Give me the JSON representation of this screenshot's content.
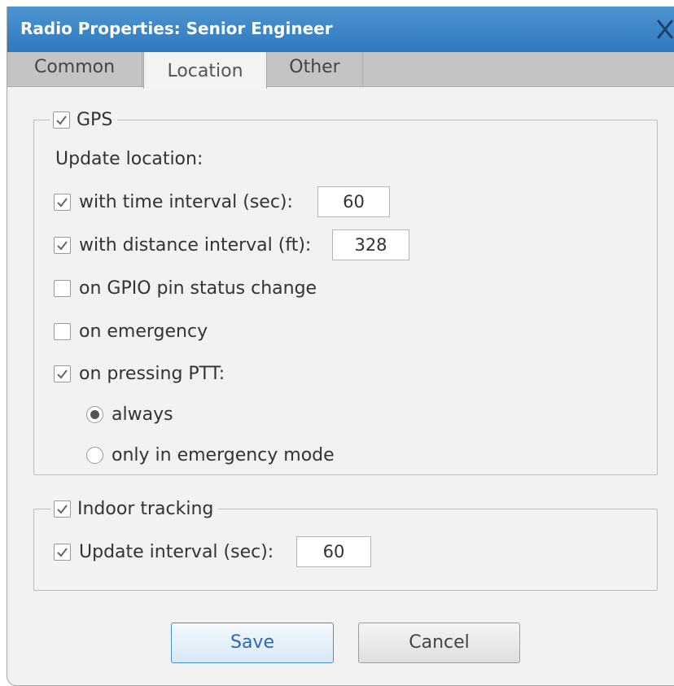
{
  "window": {
    "title": "Radio Properties: Senior Engineer"
  },
  "icons": {
    "close": "close-icon",
    "check": "checkmark-icon",
    "radio": "radio-dot-icon"
  },
  "colors": {
    "title_bar": "#3a85c8",
    "accent": "#2868b8",
    "panel": "#f2f2f2"
  },
  "tabs": [
    {
      "label": "Common",
      "selected": false
    },
    {
      "label": "Location",
      "selected": true
    },
    {
      "label": "Other",
      "selected": false
    }
  ],
  "gps": {
    "label": "GPS",
    "checked": true,
    "update_location_label": "Update location:",
    "time_interval": {
      "label": "with time interval (sec):",
      "checked": true,
      "value": "60"
    },
    "distance_interval": {
      "label": "with distance interval (ft):",
      "checked": true,
      "value": "328"
    },
    "gpio": {
      "label": "on GPIO pin status change",
      "checked": false
    },
    "emergency": {
      "label": "on emergency",
      "checked": false
    },
    "ptt": {
      "label": "on pressing PTT:",
      "checked": true,
      "options": [
        {
          "label": "always",
          "selected": true
        },
        {
          "label": "only in emergency mode",
          "selected": false
        }
      ]
    }
  },
  "indoor": {
    "label": "Indoor tracking",
    "checked": true,
    "update_interval": {
      "label": "Update interval (sec):",
      "checked": true,
      "value": "60"
    }
  },
  "buttons": {
    "save": "Save",
    "cancel": "Cancel"
  }
}
